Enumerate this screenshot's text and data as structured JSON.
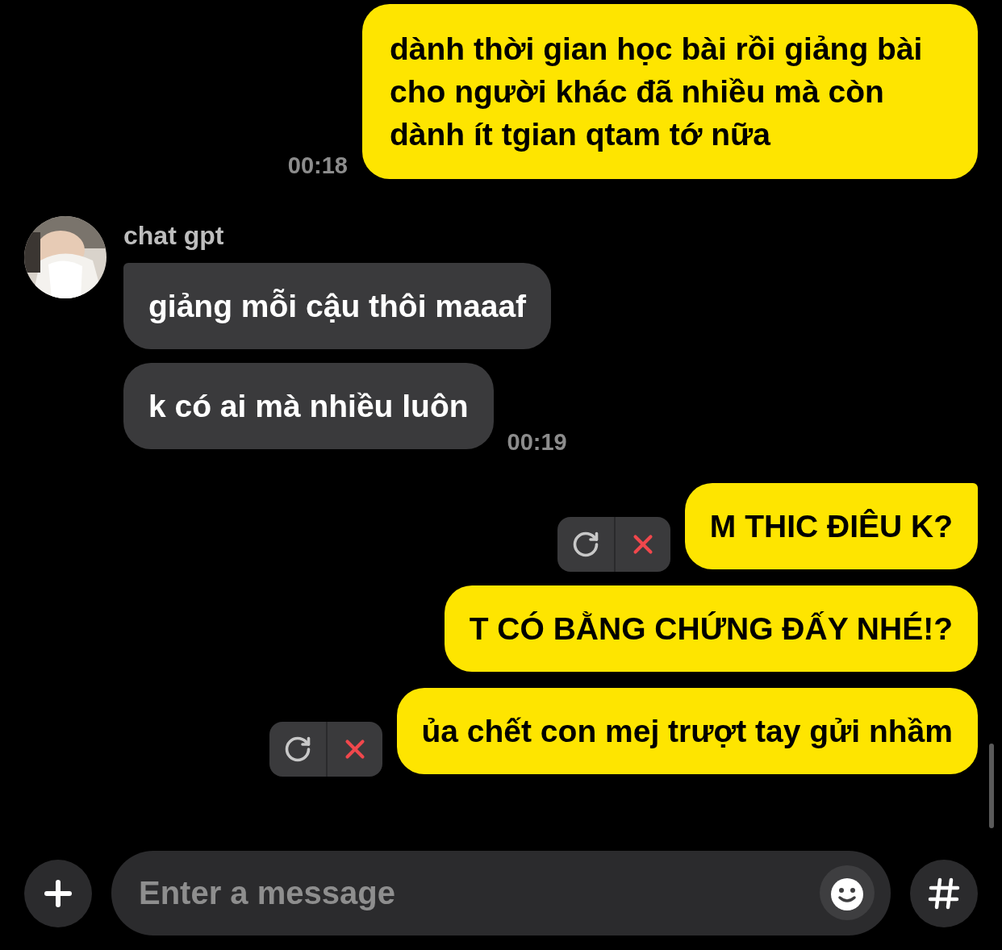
{
  "messages": [
    {
      "kind": "outgoing",
      "text": "dành thời gian học bài rồi giảng bài cho người khác đã nhiều mà còn dành ít tgian qtam tớ nữa",
      "time": "00:18",
      "tail": false,
      "failed": false
    },
    {
      "kind": "incoming_group",
      "sender": {
        "name": "chat gpt"
      },
      "bubbles": [
        {
          "text": "giảng mỗi cậu thôi maaaf",
          "tail": true
        },
        {
          "text": "k có ai mà nhiều luôn",
          "tail": false,
          "time": "00:19"
        }
      ]
    },
    {
      "kind": "outgoing",
      "text": "M THIC ĐIÊU K?",
      "tail": true,
      "failed": true
    },
    {
      "kind": "outgoing",
      "text": "T CÓ BẰNG CHỨNG ĐẤY NHÉ!?",
      "tail": false,
      "failed": false
    },
    {
      "kind": "outgoing",
      "text": "ủa chết con mej trượt tay gửi nhầm",
      "tail": false,
      "failed": true
    }
  ],
  "composer": {
    "placeholder": "Enter a message"
  }
}
